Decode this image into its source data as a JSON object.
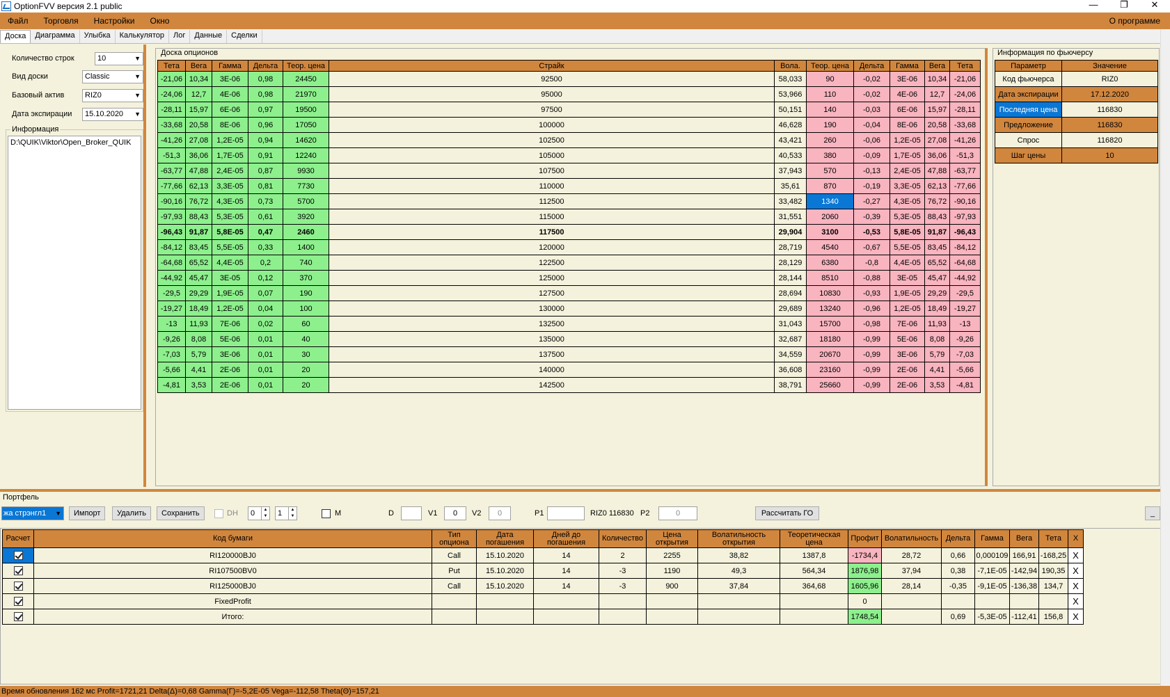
{
  "window": {
    "title": "OptionFVV версия 2.1 public",
    "min": "—",
    "restore": "❐",
    "close": "✕"
  },
  "menu": {
    "items": [
      "Файл",
      "Торговля",
      "Настройки",
      "Окно"
    ],
    "about": "О программе"
  },
  "tabs": [
    "Доска",
    "Диаграмма",
    "Улыбка",
    "Калькулятор",
    "Лог",
    "Данные",
    "Сделки"
  ],
  "left": {
    "rows_label": "Количество строк",
    "rows_value": "10",
    "view_label": "Вид доски",
    "view_value": "Classic",
    "asset_label": "Базовый актив",
    "asset_value": "RIZ0",
    "exp_label": "Дата экспирации",
    "exp_value": "15.10.2020",
    "info_label": "Информация",
    "info_text": "D:\\QUIK\\Viktor\\Open_Broker_QUIK"
  },
  "board": {
    "title": "Доска опционов",
    "headers": [
      "Тета",
      "Вега",
      "Гамма",
      "Дельта",
      "Теор. цена",
      "Страйк",
      "Вола.",
      "Теор. цена",
      "Дельта",
      "Гамма",
      "Вега",
      "Тета"
    ],
    "rows": [
      [
        "-21,06",
        "10,34",
        "3E-06",
        "0,98",
        "24450",
        "92500",
        "58,033",
        "90",
        "-0,02",
        "3E-06",
        "10,34",
        "-21,06"
      ],
      [
        "-24,06",
        "12,7",
        "4E-06",
        "0,98",
        "21970",
        "95000",
        "53,966",
        "110",
        "-0,02",
        "4E-06",
        "12,7",
        "-24,06"
      ],
      [
        "-28,11",
        "15,97",
        "6E-06",
        "0,97",
        "19500",
        "97500",
        "50,151",
        "140",
        "-0,03",
        "6E-06",
        "15,97",
        "-28,11"
      ],
      [
        "-33,68",
        "20,58",
        "8E-06",
        "0,96",
        "17050",
        "100000",
        "46,628",
        "190",
        "-0,04",
        "8E-06",
        "20,58",
        "-33,68"
      ],
      [
        "-41,26",
        "27,08",
        "1,2E-05",
        "0,94",
        "14620",
        "102500",
        "43,421",
        "260",
        "-0,06",
        "1,2E-05",
        "27,08",
        "-41,26"
      ],
      [
        "-51,3",
        "36,06",
        "1,7E-05",
        "0,91",
        "12240",
        "105000",
        "40,533",
        "380",
        "-0,09",
        "1,7E-05",
        "36,06",
        "-51,3"
      ],
      [
        "-63,77",
        "47,88",
        "2,4E-05",
        "0,87",
        "9930",
        "107500",
        "37,943",
        "570",
        "-0,13",
        "2,4E-05",
        "47,88",
        "-63,77"
      ],
      [
        "-77,66",
        "62,13",
        "3,3E-05",
        "0,81",
        "7730",
        "110000",
        "35,61",
        "870",
        "-0,19",
        "3,3E-05",
        "62,13",
        "-77,66"
      ],
      [
        "-90,16",
        "76,72",
        "4,3E-05",
        "0,73",
        "5700",
        "112500",
        "33,482",
        "1340",
        "-0,27",
        "4,3E-05",
        "76,72",
        "-90,16"
      ],
      [
        "-97,93",
        "88,43",
        "5,3E-05",
        "0,61",
        "3920",
        "115000",
        "31,551",
        "2060",
        "-0,39",
        "5,3E-05",
        "88,43",
        "-97,93"
      ],
      [
        "-96,43",
        "91,87",
        "5,8E-05",
        "0,47",
        "2460",
        "117500",
        "29,904",
        "3100",
        "-0,53",
        "5,8E-05",
        "91,87",
        "-96,43"
      ],
      [
        "-84,12",
        "83,45",
        "5,5E-05",
        "0,33",
        "1400",
        "120000",
        "28,719",
        "4540",
        "-0,67",
        "5,5E-05",
        "83,45",
        "-84,12"
      ],
      [
        "-64,68",
        "65,52",
        "4,4E-05",
        "0,2",
        "740",
        "122500",
        "28,129",
        "6380",
        "-0,8",
        "4,4E-05",
        "65,52",
        "-64,68"
      ],
      [
        "-44,92",
        "45,47",
        "3E-05",
        "0,12",
        "370",
        "125000",
        "28,144",
        "8510",
        "-0,88",
        "3E-05",
        "45,47",
        "-44,92"
      ],
      [
        "-29,5",
        "29,29",
        "1,9E-05",
        "0,07",
        "190",
        "127500",
        "28,694",
        "10830",
        "-0,93",
        "1,9E-05",
        "29,29",
        "-29,5"
      ],
      [
        "-19,27",
        "18,49",
        "1,2E-05",
        "0,04",
        "100",
        "130000",
        "29,689",
        "13240",
        "-0,96",
        "1,2E-05",
        "18,49",
        "-19,27"
      ],
      [
        "-13",
        "11,93",
        "7E-06",
        "0,02",
        "60",
        "132500",
        "31,043",
        "15700",
        "-0,98",
        "7E-06",
        "11,93",
        "-13"
      ],
      [
        "-9,26",
        "8,08",
        "5E-06",
        "0,01",
        "40",
        "135000",
        "32,687",
        "18180",
        "-0,99",
        "5E-06",
        "8,08",
        "-9,26"
      ],
      [
        "-7,03",
        "5,79",
        "3E-06",
        "0,01",
        "30",
        "137500",
        "34,559",
        "20670",
        "-0,99",
        "3E-06",
        "5,79",
        "-7,03"
      ],
      [
        "-5,66",
        "4,41",
        "2E-06",
        "0,01",
        "20",
        "140000",
        "36,608",
        "23160",
        "-0,99",
        "2E-06",
        "4,41",
        "-5,66"
      ],
      [
        "-4,81",
        "3,53",
        "2E-06",
        "0,01",
        "20",
        "142500",
        "38,791",
        "25660",
        "-0,99",
        "2E-06",
        "3,53",
        "-4,81"
      ]
    ],
    "atm_row": 10,
    "selected_cell": [
      8,
      7
    ]
  },
  "futures": {
    "title": "Информация по фьючерсу",
    "headers": [
      "Параметр",
      "Значение"
    ],
    "rows": [
      [
        "Код фьючерса",
        "RIZ0"
      ],
      [
        "Дата экспирации",
        "17.12.2020"
      ],
      [
        "Последняя цена",
        "116830"
      ],
      [
        "Предложение",
        "116830"
      ],
      [
        "Спрос",
        "116820"
      ],
      [
        "Шаг цены",
        "10"
      ]
    ]
  },
  "portfolio": {
    "title": "Портфель",
    "combo_value": "жа стрэнгл1",
    "import": "Импорт",
    "delete": "Удалить",
    "save": "Сохранить",
    "dh_label": "DH",
    "spin1": "0",
    "spin2": "1",
    "m_label": "M",
    "d_label": "D",
    "d_value": "",
    "v1_label": "V1",
    "v1_value": "0",
    "v2_label": "V2",
    "v2_value": "0",
    "p1_label": "P1",
    "p1_value": "",
    "fut_info": "RIZ0 116830",
    "p2_label": "P2",
    "p2_value": "0",
    "calc_go": "Рассчитать ГО",
    "min_btn": "_",
    "headers": [
      "Расчет",
      "Код бумаги",
      "Тип опциона",
      "Дата погашения",
      "Дней до погашения",
      "Количество",
      "Цена открытия",
      "Волатильность открытия",
      "Теоретическая цена",
      "Профит",
      "Волатильность",
      "Дельта",
      "Гамма",
      "Вега",
      "Тета",
      "X"
    ],
    "rows": [
      [
        "",
        "RI120000BJ0",
        "Call",
        "15.10.2020",
        "14",
        "2",
        "2255",
        "38,82",
        "1387,8",
        "-1734,4",
        "28,72",
        "0,66",
        "0,000109",
        "166,91",
        "-168,25",
        "X"
      ],
      [
        "",
        "RI107500BV0",
        "Put",
        "15.10.2020",
        "14",
        "-3",
        "1190",
        "49,3",
        "564,34",
        "1876,98",
        "37,94",
        "0,38",
        "-7,1E-05",
        "-142,94",
        "190,35",
        "X"
      ],
      [
        "",
        "RI125000BJ0",
        "Call",
        "15.10.2020",
        "14",
        "-3",
        "900",
        "37,84",
        "364,68",
        "1605,96",
        "28,14",
        "-0,35",
        "-9,1E-05",
        "-136,38",
        "134,7",
        "X"
      ],
      [
        "",
        "FixedProfit",
        "",
        "",
        "",
        "",
        "",
        "",
        "",
        "0",
        "",
        "",
        "",
        "",
        "",
        "X"
      ],
      [
        "",
        "Итого:",
        "",
        "",
        "",
        "",
        "",
        "",
        "",
        "1748,54",
        "",
        "0,69",
        "-5,3E-05",
        "-112,41",
        "156,8",
        "X"
      ]
    ]
  },
  "status": "Время обновления 162 мс   Profit=1721,21 Delta(Δ)=0,68 Gamma(Γ)=-5,2E-05 Vega=-112,58 Theta(Θ)=157,21"
}
